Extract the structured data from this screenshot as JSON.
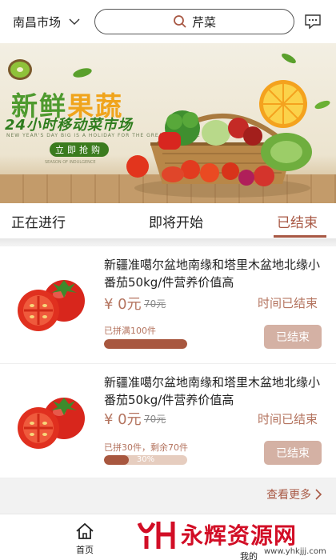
{
  "header": {
    "city": "南昌市场",
    "search_text": "芹菜"
  },
  "banner": {
    "title_part1": "新鲜",
    "title_part2": "果蔬",
    "subtitle": "24小时移动菜市场",
    "english": "NEW YEAR'S DAY BIG IS A HOLIDAY FOR THE GREAT EVERYONE",
    "button": "立即抢购",
    "small_text": "SEASON OF INDULGENCE"
  },
  "tabs": [
    {
      "label": "正在进行",
      "active": false
    },
    {
      "label": "即将开始",
      "active": false
    },
    {
      "label": "已结束",
      "active": true
    }
  ],
  "products": [
    {
      "title": "新疆准噶尔盆地南缘和塔里木盆地北缘小番茄50kg/件营养价值高",
      "price": "¥ 0元",
      "original_price": "70元",
      "time_status": "时间已结束",
      "progress_text": "已拼满100件",
      "progress": 1.0,
      "progress_label": "",
      "button": "已结束"
    },
    {
      "title": "新疆准噶尔盆地南缘和塔里木盆地北缘小番茄50kg/件营养价值高",
      "price": "¥ 0元",
      "original_price": "70元",
      "time_status": "时间已结束",
      "progress_text": "已拼30件，剩余70件",
      "progress": 0.3,
      "progress_label": "30%",
      "button": "已结束"
    }
  ],
  "more_label": "查看更多",
  "bottom_nav": {
    "home": "首页",
    "mine": "我的"
  },
  "watermark": {
    "text": "永辉资源网",
    "url": "www.yhkjjj.com"
  },
  "colors": {
    "accent": "#a85844",
    "price": "#b4745f",
    "button_disabled": "#d4b1a4"
  }
}
